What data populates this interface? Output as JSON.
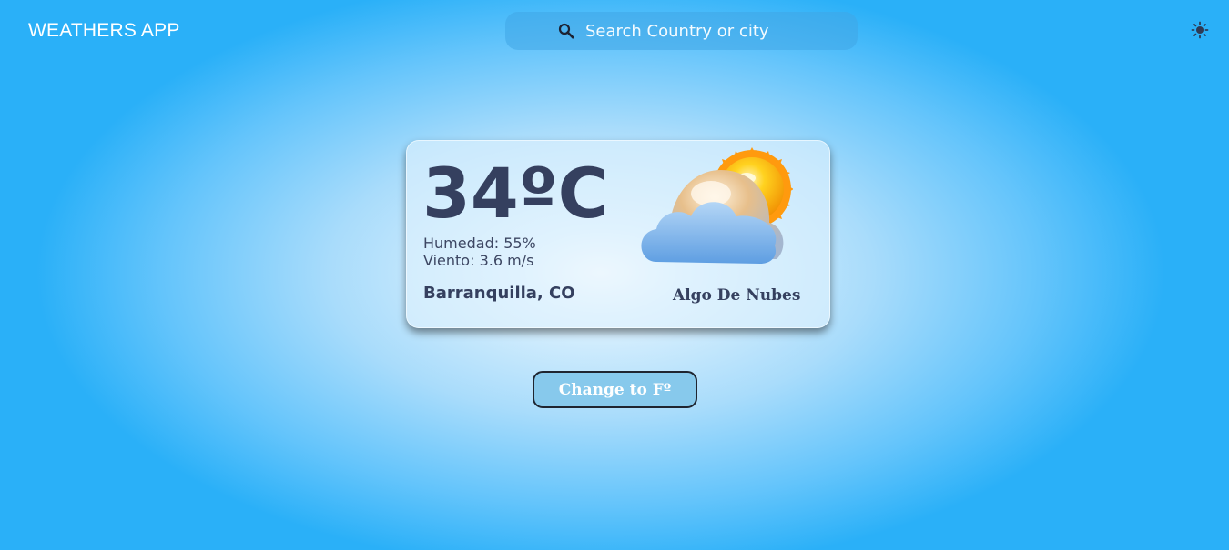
{
  "header": {
    "app_title": "WEATHERS APP",
    "search": {
      "placeholder": "Search Country or city",
      "value": "",
      "icon": "search-icon"
    },
    "theme_toggle": {
      "icon": "sun-icon"
    }
  },
  "weather_card": {
    "temperature": "34ºC",
    "humidity": "Humedad: 55%",
    "wind": "Viento: 3.6 m/s",
    "location": "Barranquilla, CO",
    "condition_icon": "partly-cloudy-icon",
    "description": "Algo De Nubes"
  },
  "unit_button": {
    "label": "Change to Fº"
  },
  "colors": {
    "text_dark": "#35405f",
    "sky_blue": "#2ab0f8",
    "button_bg": "#87c9ec",
    "sun_orange": "#ff8f00"
  }
}
